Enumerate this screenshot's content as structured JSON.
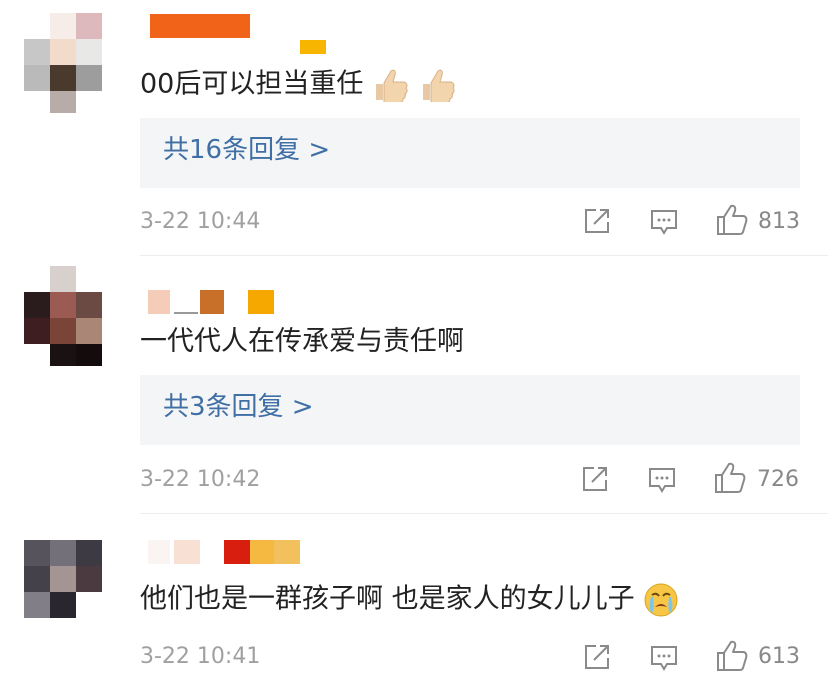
{
  "comments": [
    {
      "text": "00后可以担当重任",
      "emojis": [
        "thumbs-up",
        "thumbs-up"
      ],
      "replies": "共16条回复 >",
      "time": "3-22 10:44",
      "likes": "813"
    },
    {
      "text": "一代代人在传承爱与责任啊",
      "emojis": [],
      "replies": "共3条回复 >",
      "time": "3-22 10:42",
      "likes": "726"
    },
    {
      "text": "他们也是一群孩子啊 也是家人的女儿儿子",
      "emojis": [
        "crying-face"
      ],
      "replies": "",
      "time": "3-22 10:41",
      "likes": "613"
    }
  ],
  "colors": {
    "reply_link": "#3f6fa5",
    "meta_gray": "#a0a0a0",
    "reply_bg": "#f4f5f6"
  }
}
